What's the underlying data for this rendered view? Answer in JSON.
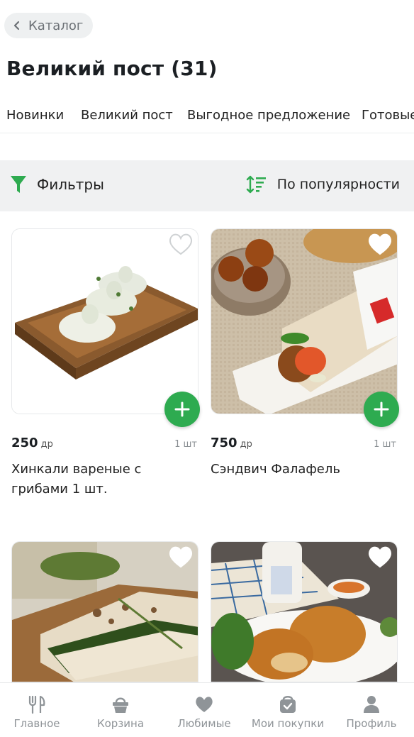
{
  "header": {
    "back_label": "Каталог",
    "title": "Великий пост (31)"
  },
  "tabs": [
    {
      "label": "Новинки",
      "active": false
    },
    {
      "label": "Великий пост",
      "active": true
    },
    {
      "label": "Выгодное предложение",
      "active": false
    },
    {
      "label": "Готовые",
      "active": false
    }
  ],
  "toolbar": {
    "filter_label": "Фильтры",
    "sort_label": "По популярности"
  },
  "products": [
    {
      "price": "250",
      "currency": "др",
      "qty": "1 шт",
      "name": "Хинкали вареные с грибами 1 шт.",
      "image_icon": "khinkali-image"
    },
    {
      "price": "750",
      "currency": "др",
      "qty": "1 шт",
      "name": "Сэндвич Фалафель",
      "image_icon": "falafel-wrap-image"
    },
    {
      "image_icon": "flatbread-image"
    },
    {
      "image_icon": "pastry-image"
    }
  ],
  "bottom_nav": [
    {
      "label": "Главное",
      "icon": "fork-knife-icon"
    },
    {
      "label": "Корзина",
      "icon": "basket-icon"
    },
    {
      "label": "Любимые",
      "icon": "heart-icon"
    },
    {
      "label": "Мои покупки",
      "icon": "bag-check-icon"
    },
    {
      "label": "Профиль",
      "icon": "person-icon"
    }
  ],
  "colors": {
    "accent": "#2eab50",
    "tab_underline": "#2e9e4d",
    "filter_bar_bg": "#f0f1f2",
    "nav_inactive": "#8f9498"
  }
}
